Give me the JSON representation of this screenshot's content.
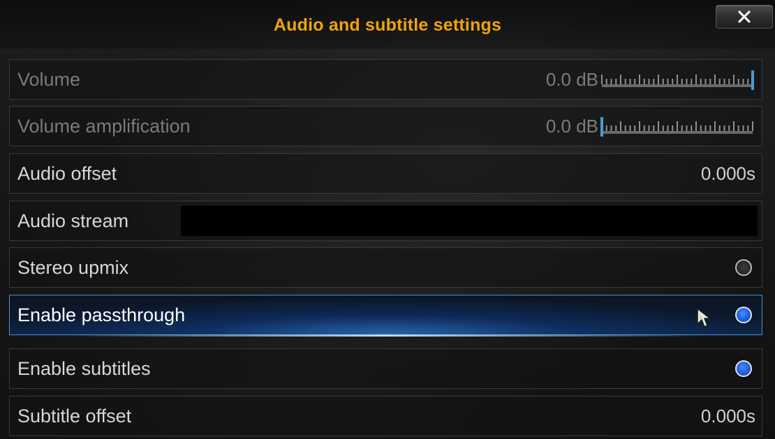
{
  "dialog": {
    "title": "Audio and subtitle settings",
    "close_icon": "close-x-icon"
  },
  "settings": {
    "volume": {
      "label": "Volume",
      "value": "0.0 dB",
      "level": 1.0,
      "enabled": false
    },
    "volume_amplification": {
      "label": "Volume amplification",
      "value": "0.0 dB",
      "level": 0.0,
      "enabled": false
    },
    "audio_offset": {
      "label": "Audio offset",
      "value": "0.000s"
    },
    "audio_stream": {
      "label": "Audio stream",
      "value": ""
    },
    "stereo_upmix": {
      "label": "Stereo upmix",
      "checked": false
    },
    "enable_passthrough": {
      "label": "Enable passthrough",
      "checked": true,
      "focused": true
    },
    "enable_subtitles": {
      "label": "Enable subtitles",
      "checked": true
    },
    "subtitle_offset": {
      "label": "Subtitle offset",
      "value": "0.000s"
    }
  },
  "colors": {
    "title": "#f0a30a",
    "focus_border": "#4a90d9",
    "radio_on": "#1f5de0",
    "slider_thumb": "#4a9ad4"
  }
}
